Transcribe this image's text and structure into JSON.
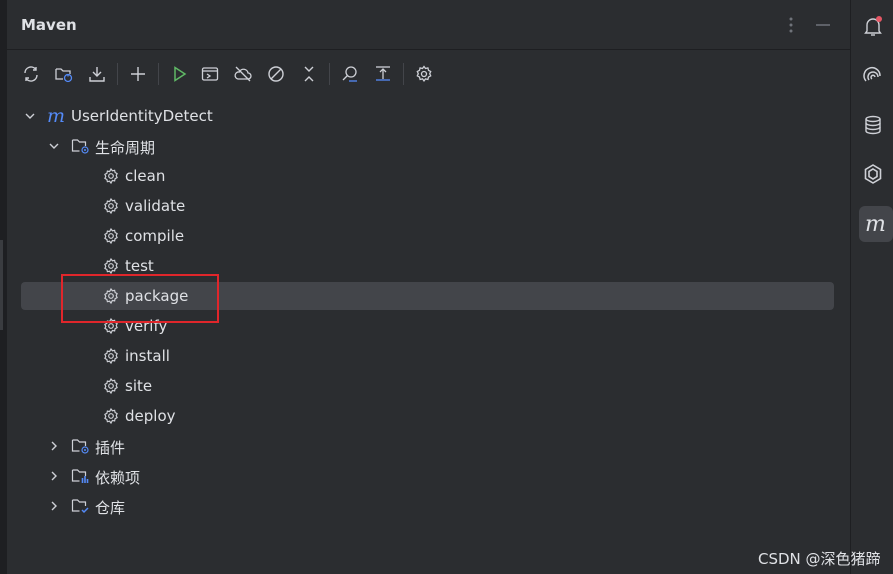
{
  "panel": {
    "title": "Maven",
    "more_icon": "vertical-ellipsis-icon",
    "minimize_icon": "minimize-icon"
  },
  "toolbar": {
    "buttons": [
      {
        "name": "reload-all-projects",
        "icon": "reload-icon"
      },
      {
        "name": "generate-sources",
        "icon": "folder-refresh-icon"
      },
      {
        "name": "download-sources",
        "icon": "download-icon"
      },
      {
        "name": "add-maven-project",
        "icon": "plus-icon"
      },
      {
        "name": "run-maven-build",
        "icon": "run-icon"
      },
      {
        "name": "execute-maven-goal",
        "icon": "terminal-icon"
      },
      {
        "name": "toggle-offline-mode",
        "icon": "offline-cloud-icon"
      },
      {
        "name": "skip-tests",
        "icon": "skip-icon"
      },
      {
        "name": "collapse-all",
        "icon": "collapse-icon"
      },
      {
        "name": "analyze-dependencies",
        "icon": "analyze-icon"
      },
      {
        "name": "show-dependencies",
        "icon": "dependencies-icon"
      },
      {
        "name": "build-tool-settings",
        "icon": "gear-icon"
      }
    ]
  },
  "tree": {
    "project": "UserIdentityDetect",
    "lifecycle": {
      "label": "生命周期",
      "goals": [
        "clean",
        "validate",
        "compile",
        "test",
        "package",
        "verify",
        "install",
        "site",
        "deploy"
      ],
      "selected": "package"
    },
    "plugins": "插件",
    "dependencies": "依赖项",
    "repositories": "仓库"
  },
  "right_bar": {
    "icons": [
      "notifications-icon",
      "ai-assistant-icon",
      "database-icon",
      "plugin-hub-icon",
      "maven-icon"
    ],
    "active": "maven-icon"
  },
  "colors": {
    "background": "#2b2d30",
    "selection": "#43454a",
    "accent_blue": "#548af7",
    "run_green": "#5fb865",
    "highlight_red": "#e0262b",
    "notification_red": "#e55765"
  },
  "watermark": "CSDN @深色猪蹄"
}
